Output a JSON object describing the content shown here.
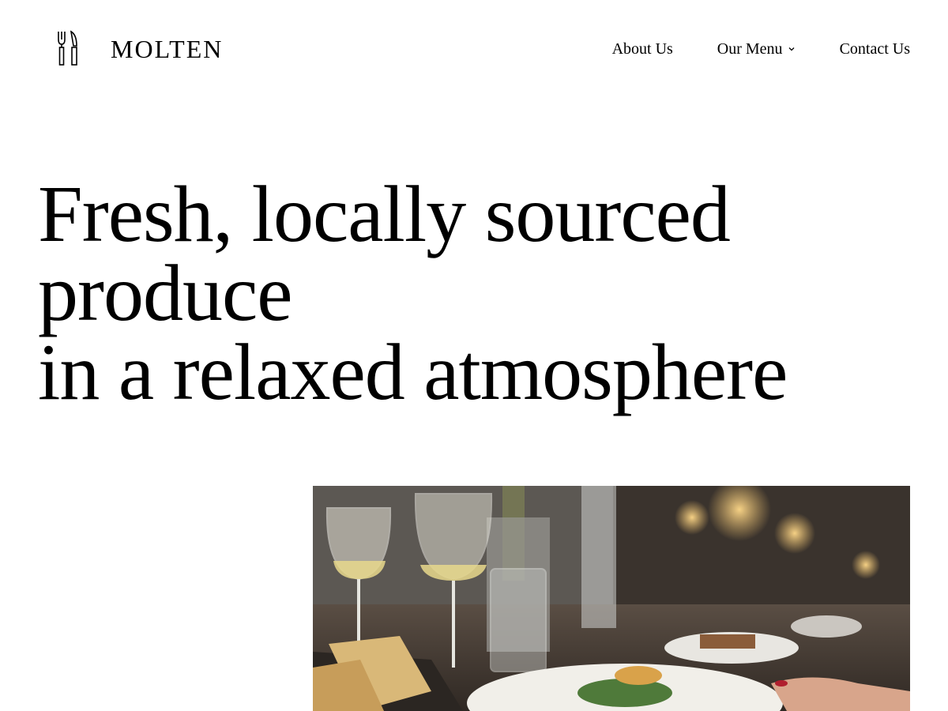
{
  "brand": {
    "name": "MOLTEN",
    "icon": "fork-knife-icon"
  },
  "nav": {
    "items": [
      {
        "label": "About Us"
      },
      {
        "label": "Our Menu",
        "icon": "chevron-down-icon"
      },
      {
        "label": "Contact Us"
      }
    ]
  },
  "hero": {
    "line1": "Fresh, locally sourced",
    "line2": "produce",
    "line3": "in a relaxed atmosphere"
  },
  "photo": {
    "subject": "restaurant table with wine glasses and plated food",
    "colors": {
      "warm_light": "#f2c26b",
      "plate": "#f1efe9",
      "glass": "#d9d8d0"
    }
  }
}
